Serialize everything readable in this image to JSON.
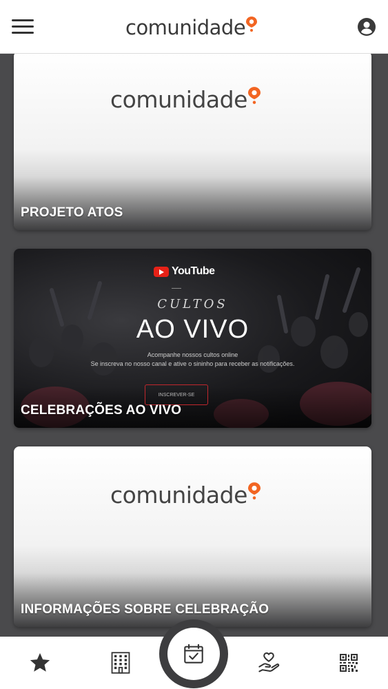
{
  "header": {
    "logo_text": "comunidade",
    "menu_icon": "hamburger-menu-icon",
    "account_icon": "account-circle-icon",
    "accent_color": "#f26522"
  },
  "cards": [
    {
      "title": "PROJETO ATOS",
      "logo_text": "comunidade"
    },
    {
      "title": "CELEBRAÇÕES AO VIVO",
      "youtube_label": "YouTube",
      "kicker": "CULTOS",
      "headline": "AO VIVO",
      "line1": "Acompanhe nossos cultos online",
      "line2": "Se inscreva no nosso canal e ative o sininho para receber as notificações.",
      "button": "INSCREVER-SE"
    },
    {
      "title": "INFORMAÇÕES SOBRE CELEBRAÇÃO",
      "logo_text": "comunidade"
    }
  ],
  "bottom_nav": {
    "items": [
      "star-icon",
      "building-icon",
      "calendar-check-icon",
      "heart-hand-icon",
      "qr-code-icon"
    ]
  }
}
